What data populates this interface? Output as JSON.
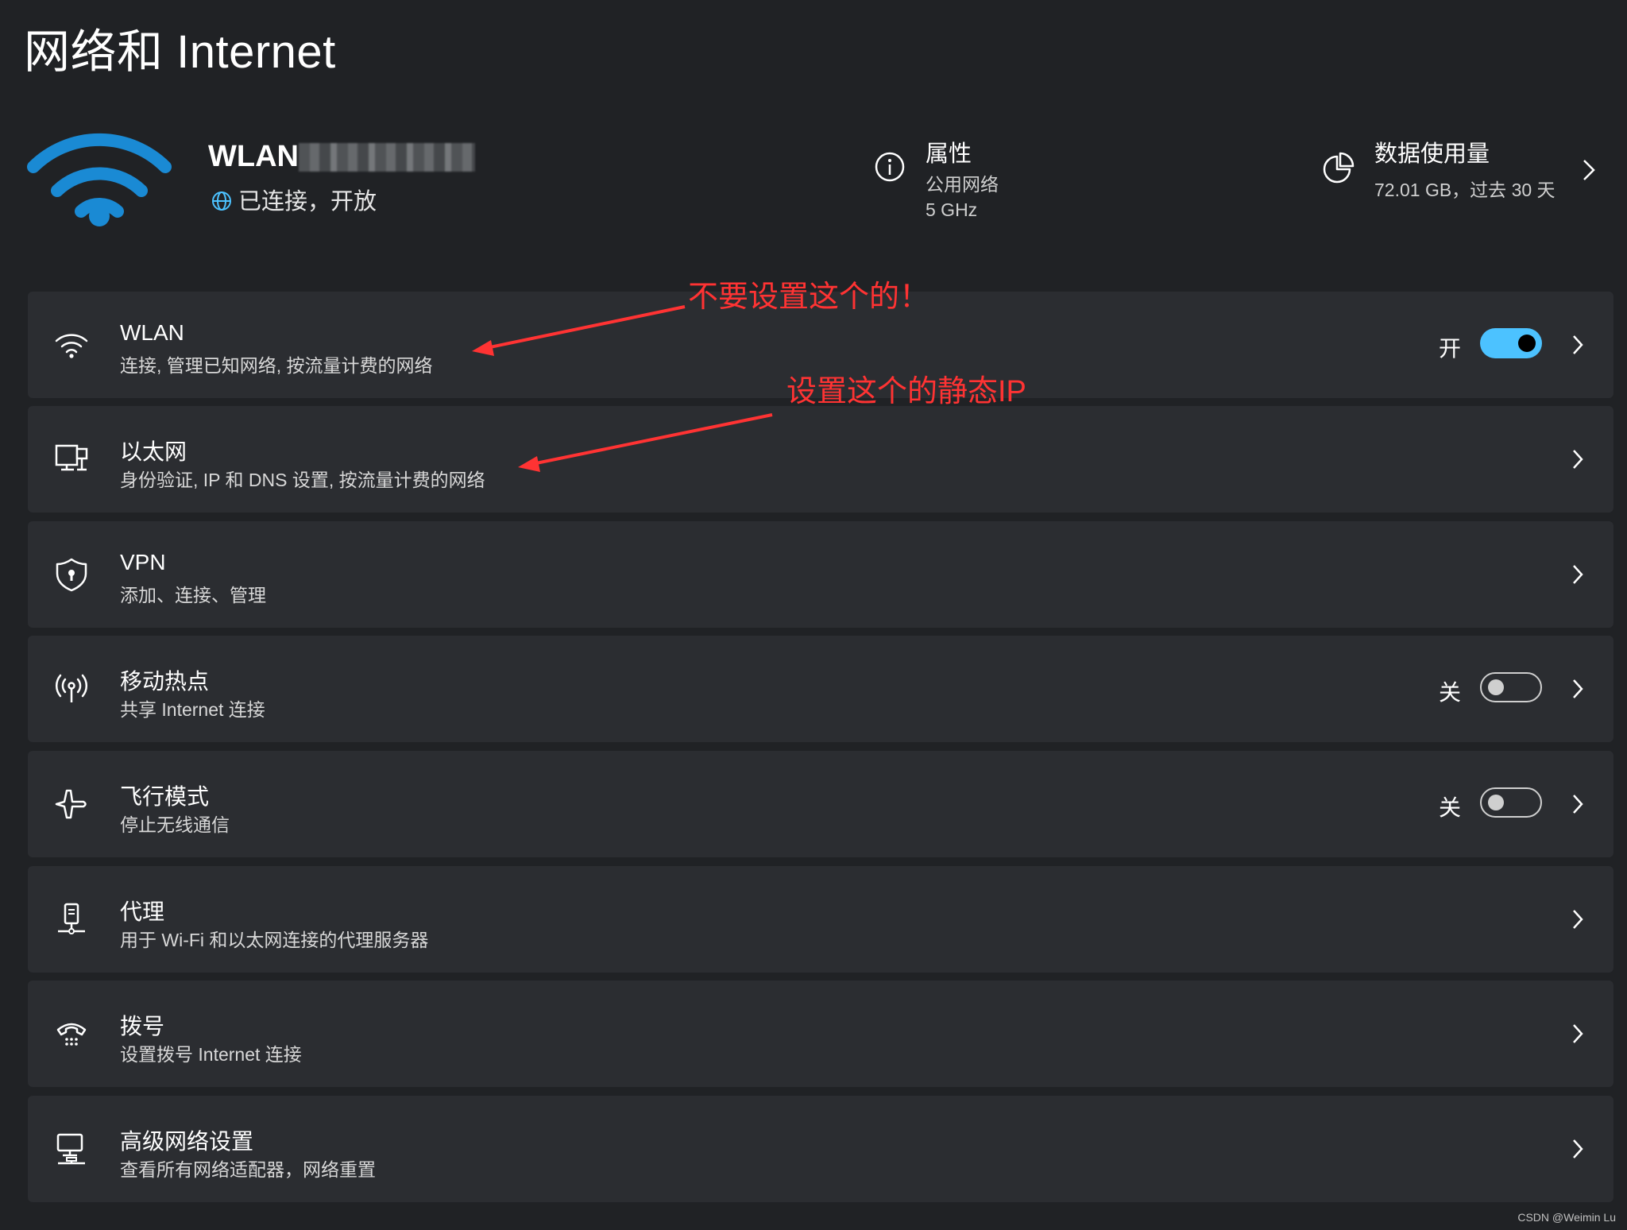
{
  "page": {
    "title": "网络和 Internet"
  },
  "header": {
    "wlan_name": "WLAN",
    "wlan_status": "已连接，开放",
    "properties": {
      "title": "属性",
      "line1": "公用网络",
      "line2": "5 GHz"
    },
    "data_usage": {
      "title": "数据使用量",
      "detail": "72.01 GB，过去 30 天"
    }
  },
  "items": [
    {
      "title": "WLAN",
      "subtitle": "连接, 管理已知网络, 按流量计费的网络",
      "toggle_label": "开",
      "toggle_state": "on"
    },
    {
      "title": "以太网",
      "subtitle": "身份验证, IP 和 DNS 设置, 按流量计费的网络"
    },
    {
      "title": "VPN",
      "subtitle": "添加、连接、管理"
    },
    {
      "title": "移动热点",
      "subtitle": "共享 Internet 连接",
      "toggle_label": "关",
      "toggle_state": "off"
    },
    {
      "title": "飞行模式",
      "subtitle": "停止无线通信",
      "toggle_label": "关",
      "toggle_state": "off"
    },
    {
      "title": "代理",
      "subtitle": "用于 Wi-Fi 和以太网连接的代理服务器"
    },
    {
      "title": "拨号",
      "subtitle": "设置拨号 Internet 连接"
    },
    {
      "title": "高级网络设置",
      "subtitle": "查看所有网络适配器，网络重置"
    }
  ],
  "annotations": {
    "wlan_note": "不要设置这个的！",
    "ethernet_note": "设置这个的静态IP"
  },
  "icons": [
    "wifi-icon",
    "ethernet-icon",
    "vpn-shield-icon",
    "hotspot-icon",
    "airplane-icon",
    "proxy-icon",
    "dialup-icon",
    "advanced-network-icon",
    "info-icon",
    "pie-chart-icon",
    "globe-icon",
    "chevron-right-icon"
  ],
  "colors": {
    "background": "#202225",
    "card": "#2b2d31",
    "accent": "#4cc2ff",
    "wifi_blue": "#1a8ad4",
    "annotation_red": "#ff3333"
  },
  "watermark": "CSDN @Weimin Lu"
}
